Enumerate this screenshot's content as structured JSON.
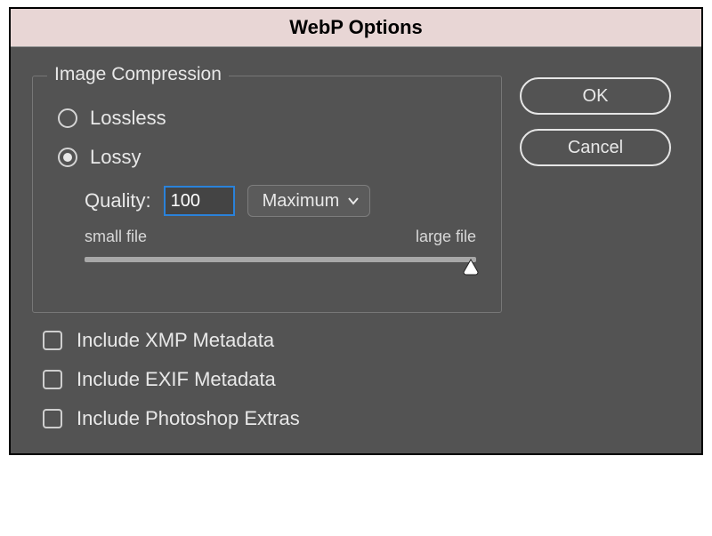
{
  "title": "WebP Options",
  "compression": {
    "legend": "Image Compression",
    "lossless_label": "Lossless",
    "lossy_label": "Lossy",
    "selected": "lossy",
    "quality_label": "Quality:",
    "quality_value": "100",
    "preset_selected": "Maximum",
    "small_label": "small file",
    "large_label": "large file"
  },
  "checkboxes": {
    "xmp_label": "Include XMP Metadata",
    "exif_label": "Include EXIF Metadata",
    "ps_label": "Include Photoshop Extras"
  },
  "buttons": {
    "ok_label": "OK",
    "cancel_label": "Cancel"
  }
}
